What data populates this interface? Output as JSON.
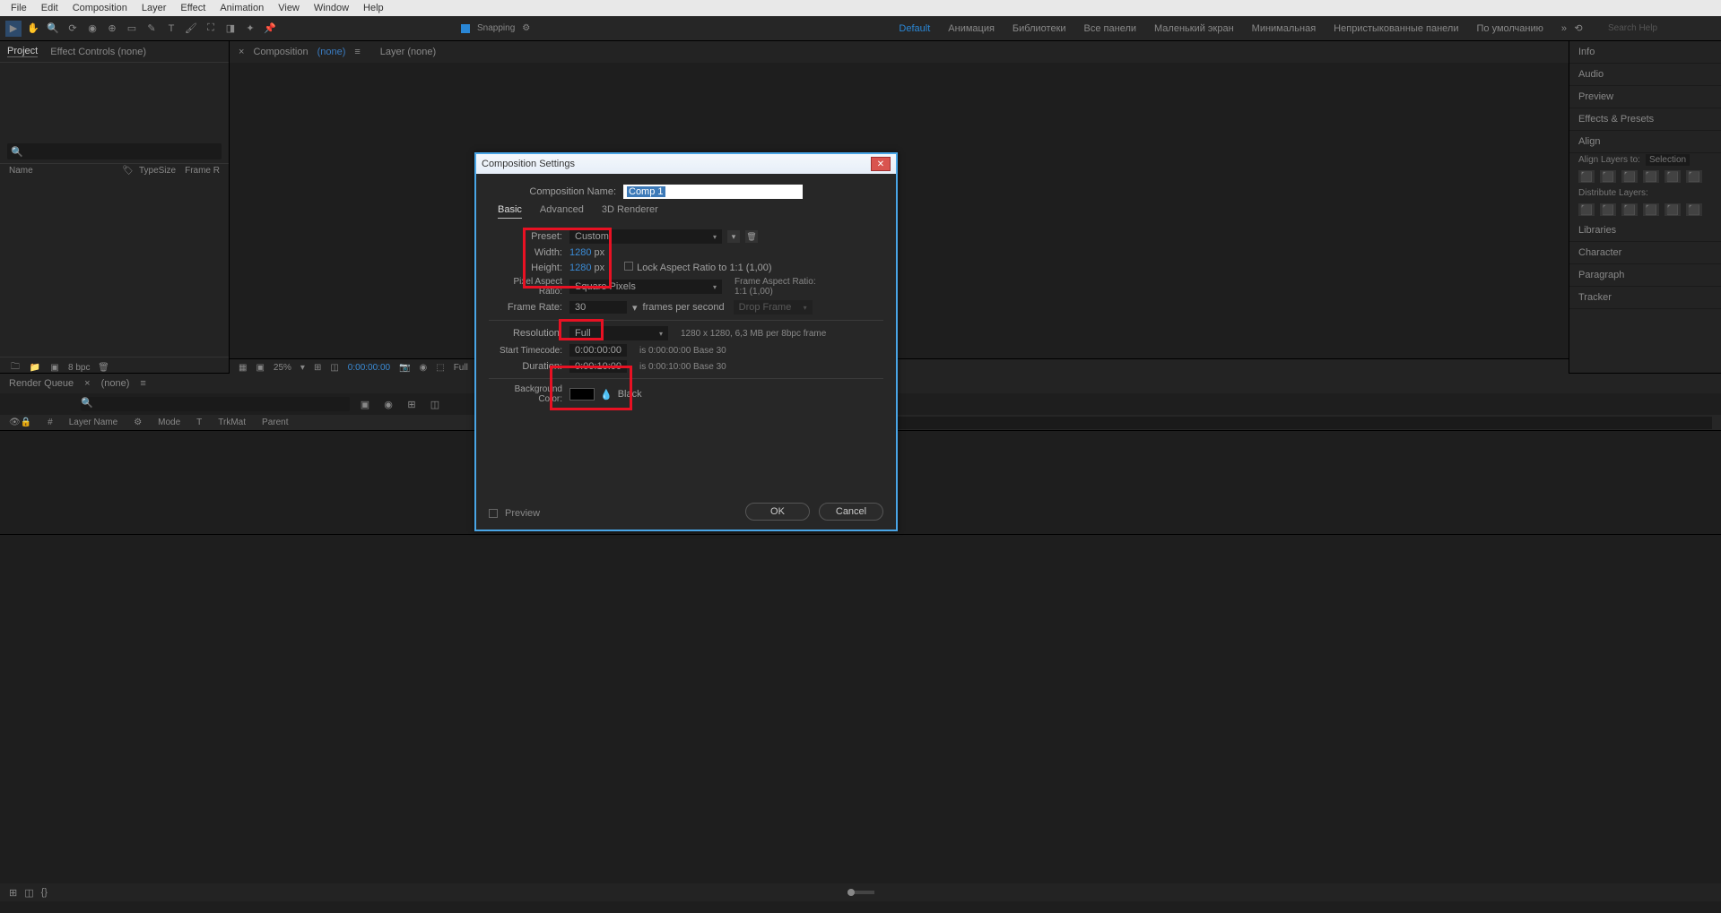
{
  "menu": [
    "File",
    "Edit",
    "Composition",
    "Layer",
    "Effect",
    "Animation",
    "View",
    "Window",
    "Help"
  ],
  "snapping_label": "Snapping",
  "workspaces": [
    "Default",
    "Анимация",
    "Библиотеки",
    "Все панели",
    "Маленький экран",
    "Минимальная",
    "Непристыкованные панели",
    "По умолчанию"
  ],
  "search_help_placeholder": "Search Help",
  "left_panel": {
    "tabs": [
      "Project",
      "Effect Controls (none)"
    ],
    "columns": [
      "Name",
      "Type",
      "Size",
      "Frame R"
    ],
    "bpc": "8 bpc"
  },
  "comp_tabs": {
    "prefix_composition": "Composition",
    "none": "(none)",
    "layer": "Layer (none)"
  },
  "viewer_footer": {
    "zoom": "25%",
    "time": "0:00:00:00",
    "full": "Full"
  },
  "right_panels": [
    "Info",
    "Audio",
    "Preview",
    "Effects & Presets",
    "Align"
  ],
  "align": {
    "layers_to": "Align Layers to:",
    "sel": "Selection",
    "dist": "Distribute Layers:"
  },
  "right_panels2": [
    "Libraries",
    "Character",
    "Paragraph",
    "Tracker"
  ],
  "timeline": {
    "tabs": [
      "Render Queue",
      "(none)"
    ],
    "cols": [
      "#",
      "Layer Name",
      "Mode",
      "T",
      "TrkMat",
      "Parent"
    ]
  },
  "dialog": {
    "title": "Composition Settings",
    "name_label": "Composition Name:",
    "name_value": "Comp 1",
    "tabs": [
      "Basic",
      "Advanced",
      "3D Renderer"
    ],
    "preset_label": "Preset:",
    "preset_value": "Custom",
    "width_label": "Width:",
    "width_value": "1280",
    "height_label": "Height:",
    "height_value": "1280",
    "px": "px",
    "lock_ar": "Lock Aspect Ratio to 1:1 (1,00)",
    "par_label": "Pixel Aspect Ratio:",
    "par_value": "Square Pixels",
    "far_label": "Frame Aspect Ratio:",
    "far_value": "1:1 (1,00)",
    "fr_label": "Frame Rate:",
    "fr_value": "30",
    "fr_unit": "frames per second",
    "drop": "Drop Frame",
    "res_label": "Resolution:",
    "res_value": "Full",
    "res_info": "1280 x 1280, 6,3 MB per 8bpc frame",
    "start_label": "Start Timecode:",
    "start_value": "0:00:00:00",
    "start_info": "is 0:00:00:00  Base 30",
    "dur_label": "Duration:",
    "dur_value": "0:00:10:00",
    "dur_info": "is 0:00:10:00  Base 30",
    "bg_label": "Background Color:",
    "bg_name": "Black",
    "preview": "Preview",
    "ok": "OK",
    "cancel": "Cancel"
  }
}
